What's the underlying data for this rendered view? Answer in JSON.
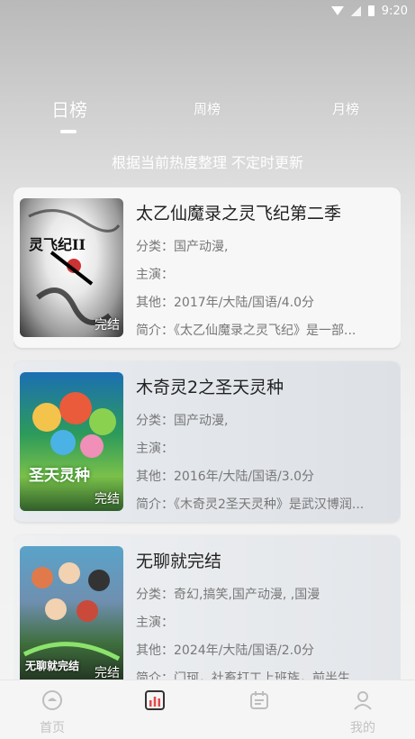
{
  "status": {
    "time": "9:20"
  },
  "tabs": [
    {
      "label": "日榜",
      "active": true
    },
    {
      "label": "周榜",
      "active": false
    },
    {
      "label": "月榜",
      "active": false
    }
  ],
  "subtitle": "根据当前热度整理 不定时更新",
  "items": [
    {
      "title": "太乙仙魔录之灵飞纪第二季",
      "category": "分类：国产动漫,",
      "cast": "主演：",
      "other": "其他：2017年/大陆/国语/4.0分",
      "summary": "简介：《太乙仙魔录之灵飞纪》是一部...",
      "badge": "完结",
      "poster_text": "灵飞纪II"
    },
    {
      "title": "木奇灵2之圣天灵种",
      "category": "分类：国产动漫,",
      "cast": "主演：",
      "other": "其他：2016年/大陆/国语/3.0分",
      "summary": "简介：《木奇灵2圣天灵种》是武汉博润...",
      "badge": "完结",
      "poster_text": "圣天灵种"
    },
    {
      "title": "无聊就完结",
      "category": "分类：奇幻,搞笑,国产动漫, ,国漫",
      "cast": "主演：",
      "other": "其他：2024年/大陆/国语/2.0分",
      "summary": "简介：门珂，社畜打工上班族，前半生...",
      "badge": "完结",
      "poster_text": "无聊就完结"
    }
  ],
  "nav": [
    {
      "label": "首页",
      "icon": "home-icon"
    },
    {
      "label": "",
      "icon": "ranking-icon"
    },
    {
      "label": "",
      "icon": "calendar-icon"
    },
    {
      "label": "我的",
      "icon": "profile-icon"
    }
  ]
}
